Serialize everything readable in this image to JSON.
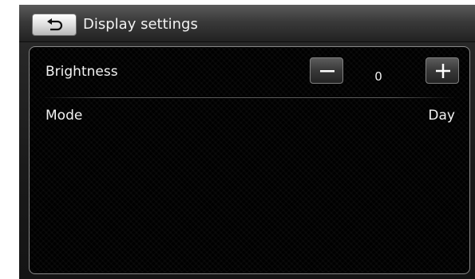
{
  "header": {
    "title": "Display settings",
    "back_icon": "back-arrow-icon"
  },
  "settings": {
    "brightness": {
      "label": "Brightness",
      "value": "0",
      "decrease_icon": "minus-icon",
      "increase_icon": "plus-icon"
    },
    "mode": {
      "label": "Mode",
      "value": "Day"
    }
  },
  "colors": {
    "text": "#f2f2f2",
    "panel_border": "#8a8a8a",
    "back_button": "#dcdcdc"
  }
}
